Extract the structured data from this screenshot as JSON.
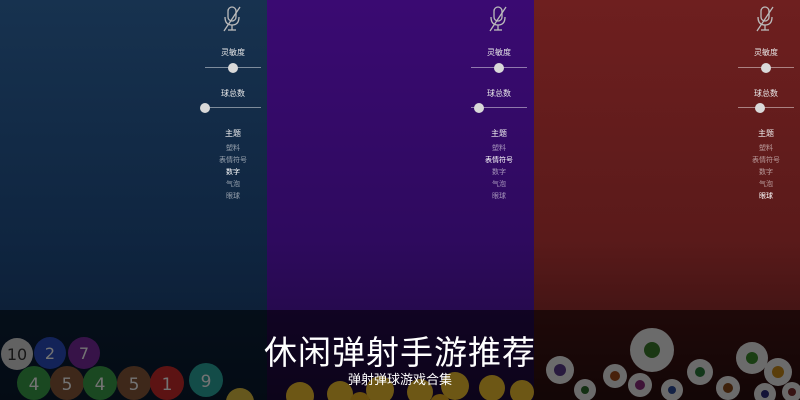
{
  "panels": [
    {
      "labels": {
        "sensitivity": "灵敏度",
        "ball_count": "球总数",
        "theme": "主题"
      },
      "sensitivity_value": 0.5,
      "ball_count_value": 0.0,
      "themes": [
        "塑料",
        "表情符号",
        "数字",
        "气泡",
        "眼球"
      ],
      "selected_theme": "数字",
      "colors": {
        "bg": "#17324f"
      }
    },
    {
      "labels": {
        "sensitivity": "灵敏度",
        "ball_count": "球总数",
        "theme": "主题"
      },
      "sensitivity_value": 0.5,
      "ball_count_value": 0.15,
      "themes": [
        "塑料",
        "表情符号",
        "数字",
        "气泡",
        "眼球"
      ],
      "selected_theme": "表情符号",
      "colors": {
        "bg": "#3a0a72"
      }
    },
    {
      "labels": {
        "sensitivity": "灵敏度",
        "ball_count": "球总数",
        "theme": "主题"
      },
      "sensitivity_value": 0.5,
      "ball_count_value": 0.4,
      "themes": [
        "塑料",
        "表情符号",
        "数字",
        "气泡",
        "眼球"
      ],
      "selected_theme": "眼球",
      "colors": {
        "bg": "#6e1f1f"
      }
    }
  ],
  "icons": {
    "mic": "microphone-muted-icon"
  },
  "banner": {
    "title": "休闲弹射手游推荐",
    "subtitle": "弹射弹球游戏合集"
  },
  "number_balls": [
    "10",
    "2",
    "7",
    "4",
    "5",
    "4",
    "5",
    "1",
    "9"
  ]
}
